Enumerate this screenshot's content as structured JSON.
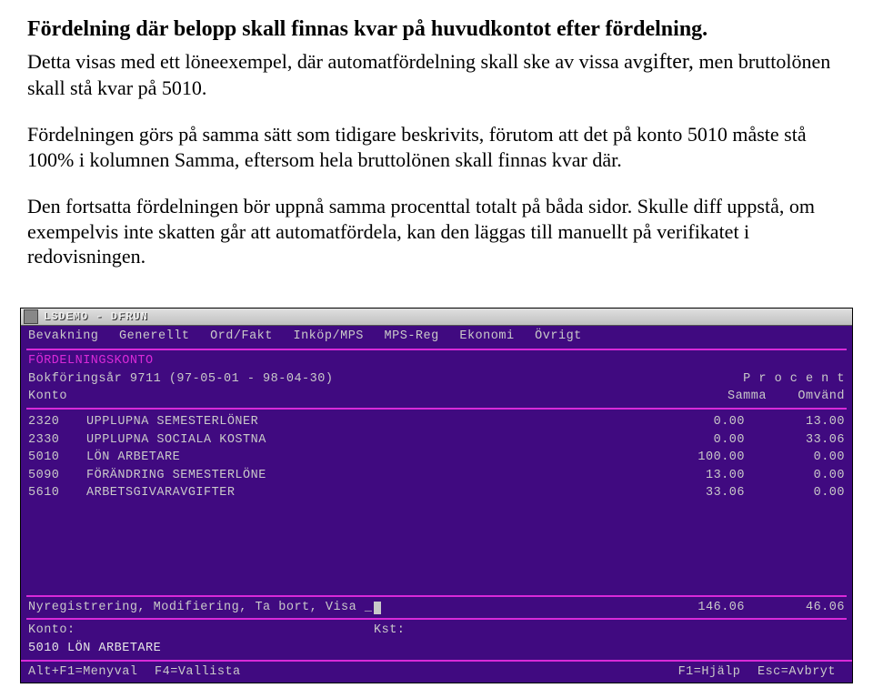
{
  "doc": {
    "heading": "Fördelning där belopp skall finnas kvar på huvudkontot efter fördelning.",
    "intro1": "Detta visas med ett löneexempel, där automatfördelning skall ske av vissa avg",
    "intro1_tail": "ifter,",
    "intro2": "men bruttolönen skall stå kvar på 5010.",
    "p2": "Fördelningen görs på samma sätt som tidigare beskrivits, förutom att det på konto 5010 måste stå 100% i kolumnen Samma, eftersom hela bruttolönen skall finnas kvar där.",
    "p3a": "Den fortsatta fördelningen bör uppnå samma procenttal totalt på båda sidor.",
    "p3b": "Skulle diff uppstå, om exempelvis inte skatten går att automatfördela, kan den läggas till manuellt på verifikatet i redovisningen."
  },
  "titlebar": {
    "text": "LSDEMO - DFRUN"
  },
  "menubar": {
    "items": [
      "Bevakning",
      "Generellt",
      "Ord/Fakt",
      "Inköp/MPS",
      "MPS-Reg",
      "Ekonomi",
      "Övrigt"
    ]
  },
  "section_title": "FÖRDELNINGSKONTO",
  "subheader": {
    "left_line": "Bokföringsår 9711 (97-05-01 - 98-04-30)",
    "right_line1": "P r o c e n t",
    "konto_label": "Konto",
    "col1": "Samma",
    "col2": "Omvänd"
  },
  "rows": [
    {
      "code": "2320",
      "name": "UPPLUPNA SEMESTERLÖNER",
      "samma": "0.00",
      "omvand": "13.00"
    },
    {
      "code": "2330",
      "name": "UPPLUPNA SOCIALA KOSTNA",
      "samma": "0.00",
      "omvand": "33.06"
    },
    {
      "code": "5010",
      "name": "LÖN ARBETARE",
      "samma": "100.00",
      "omvand": "0.00"
    },
    {
      "code": "5090",
      "name": "FÖRÄNDRING SEMESTERLÖNE",
      "samma": "13.00",
      "omvand": "0.00"
    },
    {
      "code": "5610",
      "name": "ARBETSGIVARAVGIFTER",
      "samma": "33.06",
      "omvand": "0.00"
    }
  ],
  "footer": {
    "prompt": "Nyregistrering, Modifiering, Ta bort, Visa _",
    "total1": "146.06",
    "total2": "46.06",
    "konto_label": "Konto:",
    "kst_label": "Kst:",
    "detail_line": "5010 LÖN ARBETARE"
  },
  "statusbar": {
    "left": [
      "Alt+F1=Menyval",
      "F4=Vallista"
    ],
    "right": [
      "F1=Hjälp",
      "Esc=Avbryt"
    ]
  }
}
